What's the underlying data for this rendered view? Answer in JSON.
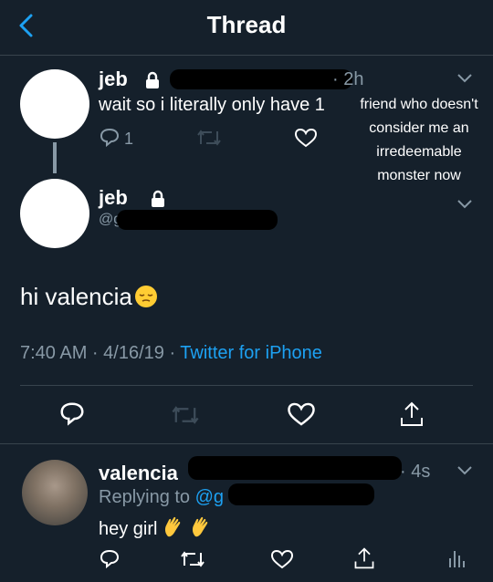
{
  "header": {
    "title": "Thread"
  },
  "tweet1": {
    "name": "jeb",
    "time": "· 2h",
    "text": "wait so i literally only have 1",
    "reply_count": "1",
    "overlay_lines": [
      "friend who doesn't",
      "consider me an",
      "irredeemable",
      "monster now"
    ]
  },
  "tweet2": {
    "name": "jeb",
    "handle_fragment": "@g",
    "text": "hi valencia",
    "timestamp": "7:40 AM · 4/16/19 · ",
    "source": "Twitter for iPhone"
  },
  "reply": {
    "name": "valencia",
    "time": "· 4s",
    "replying_prefix": "Replying to ",
    "handle_fragment": "@g",
    "text": "hey girl"
  },
  "colors": {
    "background": "#15202b",
    "accent": "#1da1f2",
    "muted": "#8899a6",
    "divider": "#38444d"
  },
  "icons": [
    "back-arrow-icon",
    "lock-icon",
    "chevron-down-icon",
    "reply-icon",
    "retweet-icon",
    "like-icon",
    "share-icon",
    "analytics-icon",
    "pensive-emoji-icon",
    "waving-hand-icon"
  ]
}
